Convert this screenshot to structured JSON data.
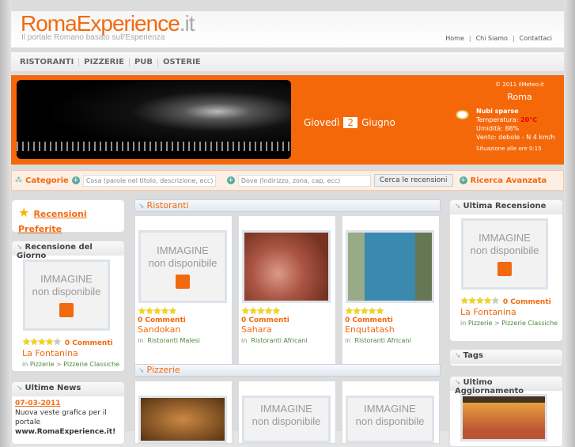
{
  "logo": {
    "main": "RomaExperience",
    "tld": ".it",
    "tagline": "Il portale Romano basato sull'Esperienza"
  },
  "toplinks": [
    "Home",
    "Chi Siamo",
    "Contattaci"
  ],
  "nav": [
    "RISTORANTI",
    "PIZZERIE",
    "PUB",
    "OSTERIE"
  ],
  "banner": {
    "weekday": "Giovedì",
    "day": "2",
    "month": "Giugno"
  },
  "meteo": {
    "credit": "© 2011 ilMeteo.it",
    "city": "Roma",
    "condition": "Nubi sparse",
    "temp_label": "Temperatura:",
    "temp": "20°C",
    "humidity": "Umidità: 88%",
    "wind": "Vento: debole - N 4 km/h",
    "updated": "Situazione alle ore 0:15"
  },
  "search": {
    "categories": "Categorie",
    "what_placeholder": "Cosa (parole nel titolo, descrizione, ecc)",
    "where_placeholder": "Dove (Indirizzo, zona, cap, ecc)",
    "button": "Cerca le recensioni",
    "advanced": "Ricerca Avanzata"
  },
  "placeholder": {
    "line1": "IMMAGINE",
    "line2": "non disponibile"
  },
  "left": {
    "favorites": "Recensioni Preferite",
    "review_of_day": {
      "title": "Recensione del Giorno",
      "rating": 4,
      "comments": "0 Commenti",
      "name": "La Fontanina",
      "in": "in",
      "cat1": "Pizzerie",
      "sep": ">",
      "cat2": "Pizzerie Classiche"
    },
    "news": {
      "title": "Ultime News",
      "date": "07-03-2011",
      "text": "Nuova veste grafica per il portale",
      "link": "www.RomaExperience.it!"
    }
  },
  "sections": [
    {
      "title": "Ristoranti",
      "items": [
        {
          "name": "Sandokan",
          "comments": "0 Commenti",
          "rating": 5,
          "in": "in",
          "category": "Ristoranti Malesi",
          "image": "none"
        },
        {
          "name": "Sahara",
          "comments": "0 Commenti",
          "rating": 5,
          "in": "in",
          "category": "Ristoranti Africani",
          "image": "photo"
        },
        {
          "name": "Enqutatash",
          "comments": "0 Commenti",
          "rating": 5,
          "in": "in",
          "category": "Ristoranti Africani",
          "image": "photo"
        }
      ]
    },
    {
      "title": "Pizzerie"
    }
  ],
  "right": {
    "last_review": {
      "title": "Ultima Recensione",
      "rating": 4,
      "comments": "0 Commenti",
      "name": "La Fontanina",
      "in": "in",
      "cat1": "Pizzerie",
      "sep": ">",
      "cat2": "Pizzerie Classiche"
    },
    "tags": "Tags",
    "last_update": "Ultimo Aggiornamento"
  }
}
